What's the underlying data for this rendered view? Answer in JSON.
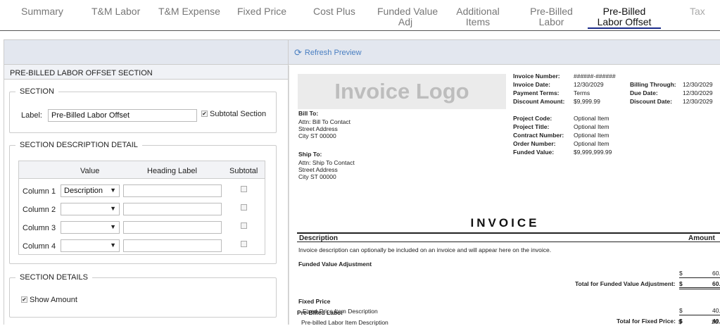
{
  "tabs": [
    {
      "label": "Summary"
    },
    {
      "label": "T&M Labor"
    },
    {
      "label": "T&M Expense"
    },
    {
      "label": "Fixed Price"
    },
    {
      "label": "Cost Plus"
    },
    {
      "label": "Funded Value\nAdj"
    },
    {
      "label": "Additional\nItems"
    },
    {
      "label": "Pre-Billed\nLabor"
    },
    {
      "label": "Pre-Billed\nLabor Offset"
    },
    {
      "label": "Tax"
    }
  ],
  "left": {
    "panel_title": "PRE-BILLED LABOR OFFSET SECTION",
    "section": {
      "legend": "SECTION",
      "label_caption": "Label:",
      "label_value": "Pre-Billed Labor Offset",
      "subtotal_caption": "Subtotal Section",
      "subtotal_checked": true
    },
    "description_detail": {
      "legend": "SECTION DESCRIPTION DETAIL",
      "headers": {
        "value": "Value",
        "heading": "Heading Label",
        "subtotal": "Subtotal"
      },
      "rows": [
        {
          "label": "Column 1",
          "value": "Description",
          "heading": "",
          "subtotal": false
        },
        {
          "label": "Column 2",
          "value": "",
          "heading": "",
          "subtotal": false
        },
        {
          "label": "Column 3",
          "value": "",
          "heading": "",
          "subtotal": false
        },
        {
          "label": "Column 4",
          "value": "",
          "heading": "",
          "subtotal": false
        }
      ]
    },
    "section_details": {
      "legend": "SECTION DETAILS",
      "show_amount_caption": "Show Amount",
      "show_amount_checked": true
    }
  },
  "right": {
    "refresh_label": "Refresh Preview",
    "invoice": {
      "logo_text": "Invoice Logo",
      "bill_to_title": "Bill To:",
      "bill_to_lines": [
        "Attn: Bill To Contact",
        "Street Address",
        "City ST 00000"
      ],
      "ship_to_title": "Ship To:",
      "ship_to_lines": [
        "Attn: Ship To Contact",
        "Street Address",
        "City ST 00000"
      ],
      "meta_a": [
        {
          "k": "Invoice Number:",
          "v": "######-######"
        },
        {
          "k": "Invoice Date:",
          "v": "12/30/2029"
        },
        {
          "k": "Payment Terms:",
          "v": "Terms"
        },
        {
          "k": "Discount Amount:",
          "v": "$9,999.99"
        }
      ],
      "meta_b": [
        {
          "k": "Billing Through:",
          "v": "12/30/2029"
        },
        {
          "k": "Due Date:",
          "v": "12/30/2029"
        },
        {
          "k": "Discount Date:",
          "v": "12/30/2029"
        }
      ],
      "meta_c": [
        {
          "k": "Project Code:",
          "v": "Optional Item"
        },
        {
          "k": "Project Title:",
          "v": "Optional Item"
        },
        {
          "k": "Contract Number:",
          "v": "Optional Item"
        },
        {
          "k": "Order Number:",
          "v": "Optional Item"
        },
        {
          "k": "Funded Value:",
          "v": "$9,999,999.99"
        }
      ],
      "title": "INVOICE",
      "col_description": "Description",
      "col_amount": "Amount",
      "intro_text": "Invoice description can optionally be included on an invoice and will appear here on the invoice.",
      "fva_title": "Funded Value Adjustment",
      "fva_currency": "$",
      "fva_amount": "60.",
      "fva_total_label": "Total for Funded Value Adjustment:",
      "fva_total_currency": "$",
      "fva_total_amount": "60.",
      "fp_title": "Fixed Price",
      "fp_item": "Fixed-Price Item Description",
      "fp_currency": "$",
      "fp_amount": "40.",
      "fp_total_label": "Total for Fixed Price:",
      "fp_total_currency": "$",
      "fp_total_amount": "40.",
      "pbl_title": "Pre-Billed Labor",
      "pbl_item": "Pre-billed Labor Item Description",
      "pbl_currency": "$",
      "pbl_amount": "20."
    }
  }
}
